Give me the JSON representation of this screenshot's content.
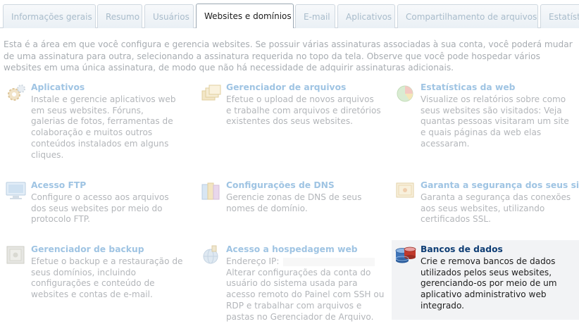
{
  "tabs": [
    {
      "label": "Informações gerais"
    },
    {
      "label": "Resumo"
    },
    {
      "label": "Usuários"
    },
    {
      "label": "Websites e domínios"
    },
    {
      "label": "E-mail"
    },
    {
      "label": "Aplicativos"
    },
    {
      "label": "Compartilhamento de arquivos"
    },
    {
      "label": "Estatísti"
    }
  ],
  "active_tab": "Websites e domínios",
  "intro": "Esta é a área em que você configura e gerencia websites. Se possuir várias assinaturas associadas à sua conta, você poderá mudar de uma assinatura para outra, selecionando a assinatura requerida no topo da tela. Observe que você pode hospedar vários websites em uma única assinatura, de modo que não há necessidade de adquirir assinaturas adicionais.",
  "cards": [
    {
      "title": "Aplicativos",
      "icon": "applications-gear-icon",
      "desc": "Instale e gerencie aplicativos web em seus websites. Fóruns, galerias de fotos, ferramentas de colaboração e muitos outros conteúdos instalados em alguns cliques."
    },
    {
      "title": "Gerenciador de arquivos",
      "icon": "folders-icon",
      "desc": "Efetue o upload de novos arquivos e trabalhe com arquivos e diretórios existentes dos seus websites."
    },
    {
      "title": "Estatísticas da web",
      "icon": "pie-chart-icon",
      "desc": "Visualize os relatórios sobre como seus websites são visitados: Veja quantas pessoas visitaram um site e quais páginas da web elas acessaram."
    },
    {
      "title": "Acesso FTP",
      "icon": "ftp-monitor-icon",
      "desc": "Configure o acesso aos arquivos dos seus websites por meio do protocolo FTP."
    },
    {
      "title": "Configurações de DNS",
      "icon": "dns-books-icon",
      "desc": "Gerencie zonas de DNS de seus nomes de domínio."
    },
    {
      "title": "Garanta a segurança dos seus sites.",
      "icon": "certificate-icon",
      "desc": "Garanta a segurança das conexões aos seus websites, utilizando certificados SSL."
    },
    {
      "title": "Gerenciador de backup",
      "icon": "safe-icon",
      "desc": "Efetue o backup e a restauração de seus domínios, incluindo configurações e conteúdo de websites e contas de e-mail."
    },
    {
      "title": "Acesso a hospedagem web",
      "icon": "globe-icon",
      "ip_label": "Endereço IP:",
      "desc": "Alterar configurações da conta do usuário do sistema usada para acesso remoto do Painel com SSH ou RDP e trabalhar com arquivos e pastas no Gerenciador de Arquivo."
    },
    {
      "title": "Bancos de dados",
      "icon": "database-icon",
      "desc": "Crie e remova bancos de dados utilizados pelos seus websites, gerenciando-os por meio de um aplicativo administrativo web integrado."
    }
  ],
  "colors": {
    "tab_text_inactive": "#a9bccb",
    "title_faded": "#9fc4e3",
    "title_active": "#0e3d74",
    "desc_faded": "#b3b6ba",
    "desc_active": "#1d1d1d",
    "hover_bg": "#f2f3f5"
  }
}
